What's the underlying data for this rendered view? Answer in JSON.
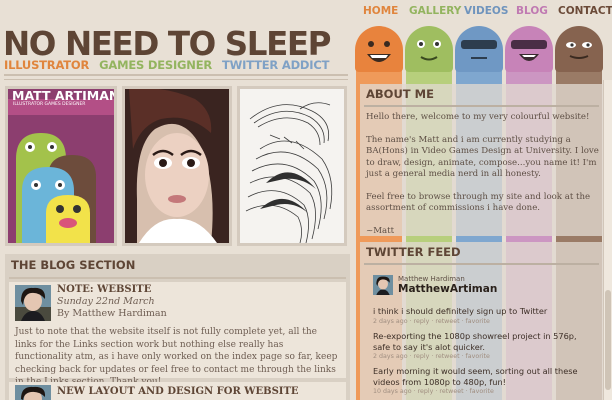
{
  "site": {
    "title": "NO NEED TO SLEEP",
    "tagline": [
      {
        "text": "ILLUSTRATOR",
        "color": "#e0853d"
      },
      {
        "text": "GAMES DESIGNER",
        "color": "#93b45f"
      },
      {
        "text": "TWITTER ADDICT",
        "color": "#7fa1c5"
      }
    ]
  },
  "nav": [
    {
      "label": "HOME",
      "color": "#e0853d"
    },
    {
      "label": "GALLERY",
      "color": "#93b45f"
    },
    {
      "label": "VIDEOS",
      "color": "#6f94bd"
    },
    {
      "label": "BLOG",
      "color": "#c07ab2"
    },
    {
      "label": "CONTACT",
      "color": "#6b4a38"
    }
  ],
  "portfolio": {
    "poster_title": "MATT ARTIMAN",
    "poster_subtitle": "ILLUSTRATOR   GAMES DESIGNER"
  },
  "blog": {
    "heading": "THE BLOG SECTION",
    "posts": [
      {
        "title": "NOTE: WEBSITE",
        "date": "Sunday 22nd March",
        "author": "By Matthew Hardiman",
        "body": "Just to note that the website itself is not fully complete yet, all the links for the Links section work but nothing else really has functionality atm, as i have only worked on the index page so far, keep checking back for updates or feel free to contact me through the links in the Links section. Thank you!"
      },
      {
        "title": "NEW LAYOUT AND DESIGN FOR WEBSITE"
      }
    ]
  },
  "about": {
    "heading": "ABOUT ME",
    "paragraphs": [
      "Hello there, welcome to my very colourful website!",
      "The name's Matt and i am currently studying a BA(Hons) in Video Games Design at University. I love to draw, design, animate, compose...you name it! I'm just a general media nerd in all honesty.",
      "Feel free to browse through my site and look at the assortment of commissions i have done.",
      "~Matt"
    ]
  },
  "twitter": {
    "heading": "TWITTER FEED",
    "user_name": "Matthew Hardiman",
    "user_handle": "MatthewArtiman",
    "tweets": [
      {
        "text": "i think i should definitely sign up to Twitter",
        "meta": "2 days ago · reply · retweet · favorite"
      },
      {
        "text": "Re-exporting the 1080p showreel project in 576p, safe to say it's alot quicker.",
        "meta": "2 days ago · reply · retweet · favorite"
      },
      {
        "text": "Early morning it would seem, sorting out all these videos from 1080p to 480p, fun!",
        "meta": "10 days ago · reply · retweet · favorite"
      }
    ]
  },
  "colors": {
    "orange": "#e0853d",
    "green": "#93b45f",
    "blue": "#6f94bd",
    "pink": "#c07ab2",
    "brown": "#7a5a48"
  }
}
